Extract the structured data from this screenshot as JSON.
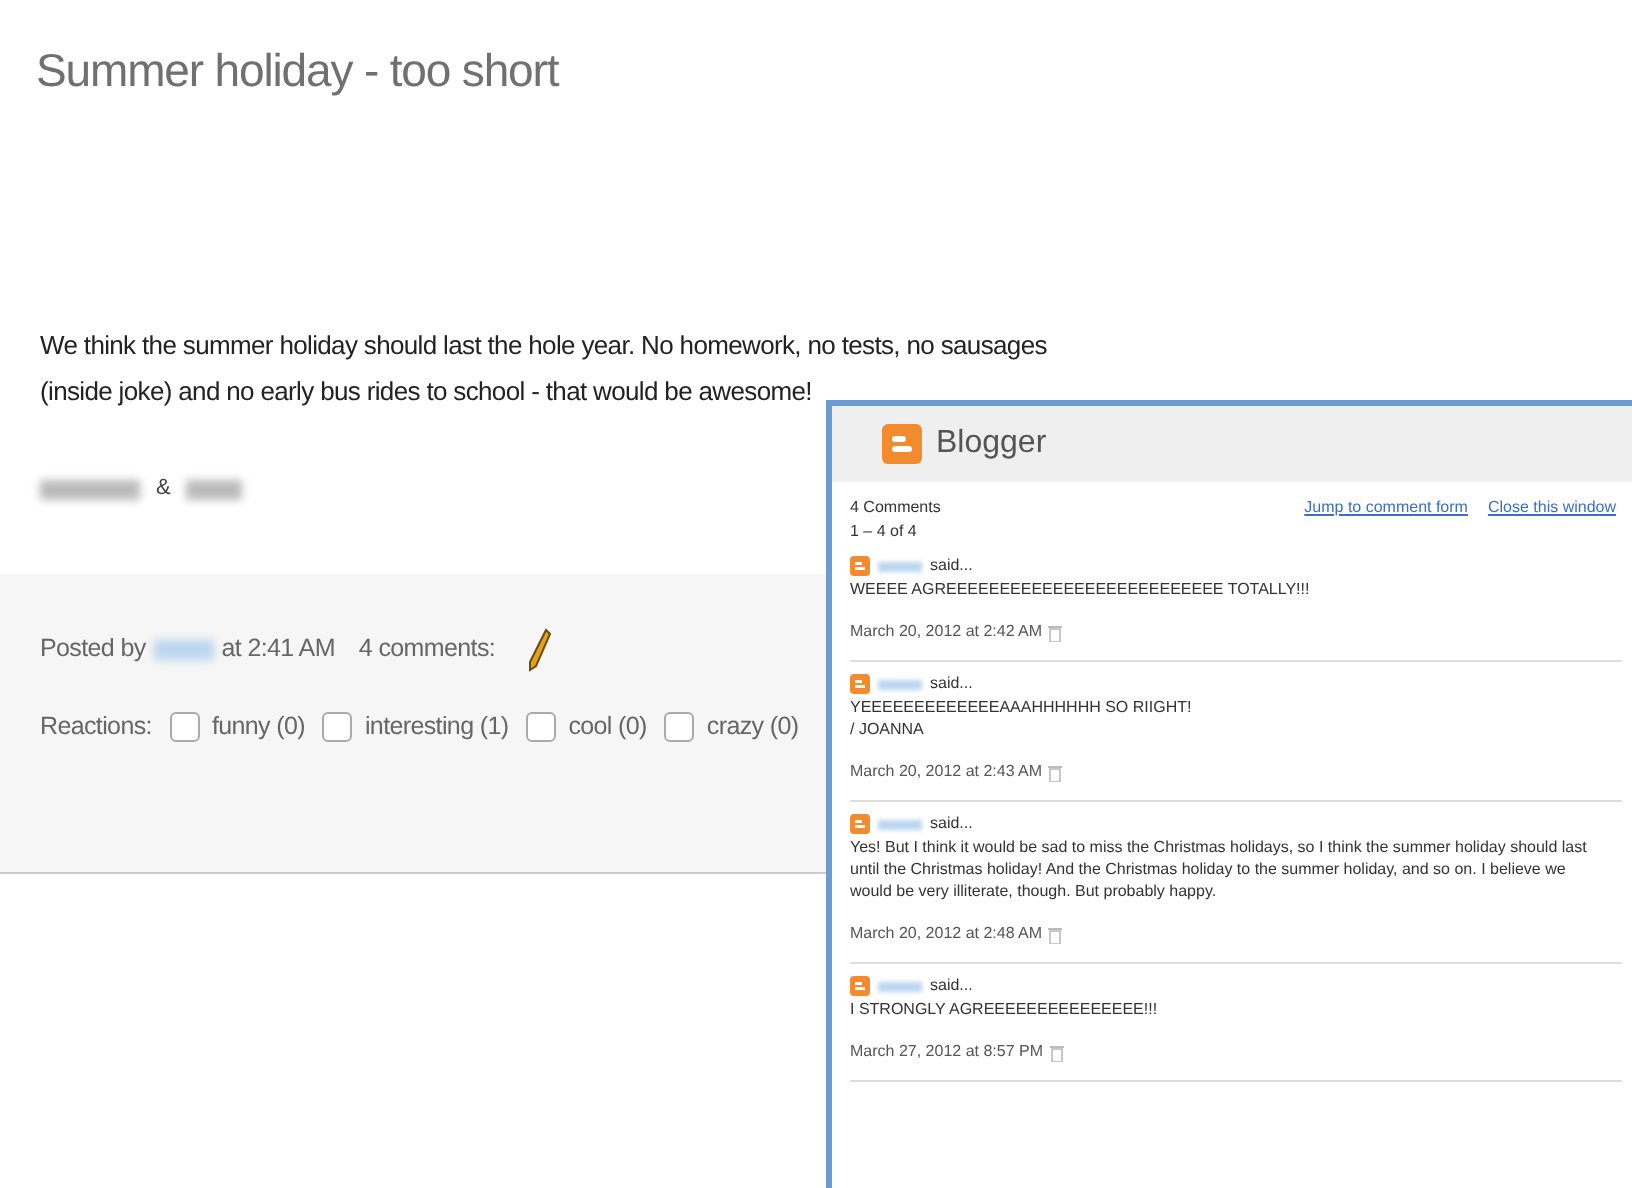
{
  "post": {
    "title": "Summer holiday - too short",
    "body": "We think the summer holiday should last the hole year. No homework, no tests, no sausages (inside joke) and no early bus rides to school - that would be awesome!",
    "signature_separator": "&",
    "footer": {
      "posted_by": "Posted by",
      "time": "at 2:41 AM",
      "comments_link": "4 comments:",
      "reactions_label": "Reactions:",
      "reactions": [
        {
          "label": "funny (0)",
          "checked": false
        },
        {
          "label": "interesting (1)",
          "checked": false
        },
        {
          "label": "cool (0)",
          "checked": false
        },
        {
          "label": "crazy (0)",
          "checked": false
        }
      ]
    }
  },
  "comments_window": {
    "title": "Blogger",
    "count": "4 Comments",
    "range": "1 – 4 of 4",
    "links": [
      "Jump to comment form",
      "Close this window"
    ],
    "comments": [
      {
        "said": "said...",
        "text": "WEEEE AGREEEEEEEEEEEEEEEEEEEEEEEEEE TOTALLY!!!",
        "date": "March 20, 2012 at 2:42 AM"
      },
      {
        "said": "said...",
        "text": "YEEEEEEEEEEEEEAAAHHHHHH SO RIIGHT!\n/ JOANNA",
        "date": "March 20, 2012 at 2:43 AM"
      },
      {
        "said": "said...",
        "text": "Yes! But I think it would be sad to miss the Christmas holidays, so I think the summer holiday should last until the Christmas holiday! And the Christmas holiday to the summer holiday, and so on. I believe we would be very illiterate, though. But probably happy.",
        "date": "March 20, 2012 at 2:48 AM"
      },
      {
        "said": "said...",
        "text": "I STRONGLY AGREEEEEEEEEEEEEEE!!!",
        "date": "March 27, 2012 at 8:57 PM"
      }
    ]
  }
}
